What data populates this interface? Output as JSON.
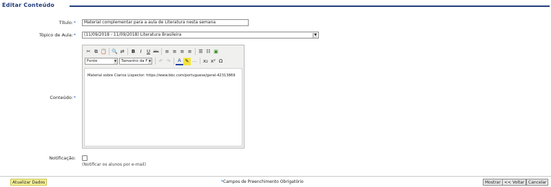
{
  "page": {
    "title": "Editar Conteúdo"
  },
  "form": {
    "titulo": {
      "label": "Título:",
      "value": "Material complementar para a aula de Literatura nesta semana"
    },
    "topico": {
      "label": "Tópico de Aula:",
      "selected": "(11/09/2018 - 11/09/2018) Literatura Brasileira"
    },
    "conteudo": {
      "label": "Conteúdo:",
      "font_select": "Fonte",
      "size_select": "Tamanho da F",
      "body_text": "Material sobre Clarice Lispector: https://www.bbc.com/portuguese/geral-42313869"
    },
    "notificacao": {
      "label": "Notificação:",
      "hint": "(Notificar os alunos por e-mail)"
    },
    "required_mark": "*"
  },
  "toolbar": {
    "row1": [
      {
        "name": "cut-icon",
        "glyph": "✂"
      },
      {
        "name": "copy-icon",
        "glyph": "⧉"
      },
      {
        "name": "paste-icon",
        "glyph": "📋"
      },
      {
        "name": "find-icon",
        "glyph": "🔍"
      },
      {
        "name": "replace-icon",
        "glyph": "⇄"
      },
      {
        "name": "bold-icon",
        "glyph": "B"
      },
      {
        "name": "italic-icon",
        "glyph": "I"
      },
      {
        "name": "underline-icon",
        "glyph": "U"
      },
      {
        "name": "strikethrough-icon",
        "glyph": "abc"
      },
      {
        "name": "align-left-icon",
        "glyph": "≡"
      },
      {
        "name": "align-center-icon",
        "glyph": "≡"
      },
      {
        "name": "align-right-icon",
        "glyph": "≡"
      },
      {
        "name": "align-justify-icon",
        "glyph": "≡"
      },
      {
        "name": "bullet-list-icon",
        "glyph": "☰"
      },
      {
        "name": "numbered-list-icon",
        "glyph": "☷"
      },
      {
        "name": "insert-image-icon",
        "glyph": "▣"
      }
    ],
    "row2": [
      {
        "name": "undo-icon",
        "glyph": "↶"
      },
      {
        "name": "redo-icon",
        "glyph": "↷"
      },
      {
        "name": "text-color-icon",
        "glyph": "A"
      },
      {
        "name": "highlight-color-icon",
        "glyph": "✎"
      },
      {
        "name": "horizontal-rule-icon",
        "glyph": "—"
      },
      {
        "name": "subscript-icon",
        "glyph": "x₂"
      },
      {
        "name": "superscript-icon",
        "glyph": "x²"
      },
      {
        "name": "special-char-icon",
        "glyph": "Ω"
      }
    ]
  },
  "footer": {
    "update_button": "Atualizar Dados",
    "required_note": "Campos de Preenchimento Obrigatório",
    "show_button": "Mostrar",
    "back_button": "<< Voltar",
    "cancel_button": "Cancelar"
  },
  "colors": {
    "accent": "#1f3a7a",
    "required": "#2a5fb8",
    "highlight_button": "#f5f29a"
  }
}
